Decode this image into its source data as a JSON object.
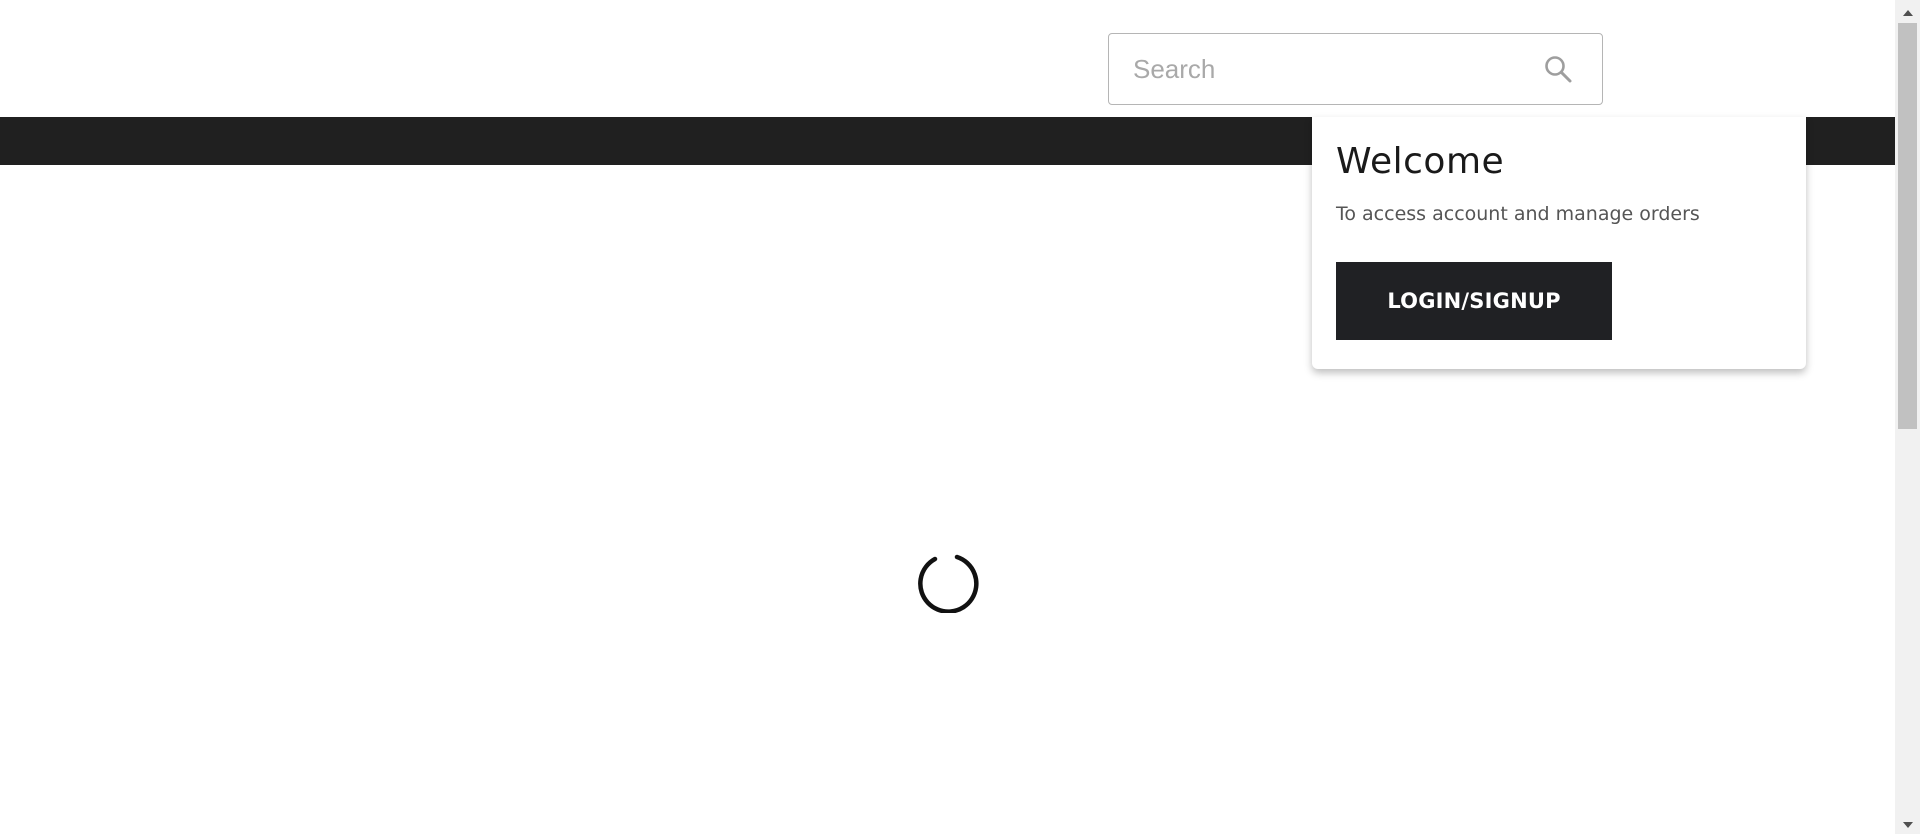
{
  "search": {
    "placeholder": "Search",
    "value": ""
  },
  "icons": {
    "search": "search-icon",
    "spinner": "loading-spinner",
    "scroll_up": "chevron-up-icon",
    "scroll_down": "chevron-down-icon"
  },
  "welcome": {
    "title": "Welcome",
    "subtitle": "To access account and manage orders",
    "button_label": "LOGIN/SIGNUP"
  },
  "colors": {
    "nav_bar": "#202020",
    "button_bg": "#202124",
    "button_text": "#ffffff",
    "search_border": "#b5b5b5"
  },
  "scrollbar": {
    "position_fraction": 0
  }
}
